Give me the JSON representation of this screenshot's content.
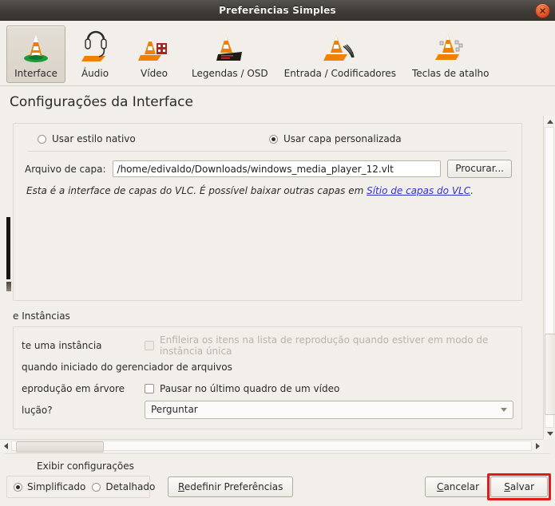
{
  "window": {
    "title": "Preferências Simples",
    "close_icon": "close-icon"
  },
  "toolbar": {
    "items": [
      {
        "label": "Interface",
        "icon": "vlc-cone-interface-icon",
        "selected": true
      },
      {
        "label": "Áudio",
        "icon": "vlc-cone-headphones-icon",
        "selected": false
      },
      {
        "label": "Vídeo",
        "icon": "vlc-cone-film-icon",
        "selected": false
      },
      {
        "label": "Legendas / OSD",
        "icon": "vlc-cone-subtitles-icon",
        "selected": false
      },
      {
        "label": "Entrada / Codificadores",
        "icon": "vlc-cone-input-icon",
        "selected": false
      },
      {
        "label": "Teclas de atalho",
        "icon": "vlc-cone-keyboard-icon",
        "selected": false
      }
    ]
  },
  "page": {
    "title": "Configurações da Interface"
  },
  "look_and_feel": {
    "native_style": {
      "label": "Usar estilo nativo",
      "selected": false
    },
    "custom_skin": {
      "label": "Usar capa personalizada",
      "selected": true
    },
    "skin_file_label": "Arquivo de capa:",
    "skin_file_value": "/home/edivaldo/Downloads/windows_media_player_12.vlt",
    "browse_label": "Procurar...",
    "hint_prefix": "Esta é a interface de capas do VLC. É possível baixar outras capas em ",
    "hint_link": "Sítio de capas do VLC",
    "hint_suffix": "."
  },
  "playlist_section": {
    "title": "e Instâncias",
    "rows": [
      {
        "label": "te uma instância",
        "checkbox_label": "Enfileira os itens na lista de reprodução quando estiver em modo de instância única",
        "checked": false,
        "disabled": true
      },
      {
        "label": "quando iniciado do gerenciador de arquivos",
        "checkbox_label": "",
        "checked": false,
        "disabled": false
      },
      {
        "label": "eprodução em árvore",
        "checkbox_label": "Pausar no último quadro de um vídeo",
        "checked": false,
        "disabled": false
      }
    ],
    "dropdown_label": "lução?",
    "dropdown_value": "Perguntar"
  },
  "scrollbars": {
    "v_up_icon": "triangle-up-icon",
    "v_down_icon": "triangle-down-icon",
    "h_left_icon": "triangle-left-icon",
    "h_right_icon": "triangle-right-icon"
  },
  "footer": {
    "show_settings_label": "Exibir configurações",
    "simple_label": "Simplificado",
    "simple_selected": true,
    "advanced_label": "Detalhado",
    "advanced_selected": false,
    "reset_label_mnemonic": "R",
    "reset_label_rest": "edefinir Preferências",
    "cancel_label_mnemonic": "C",
    "cancel_label_rest": "ancelar",
    "save_label_mnemonic": "S",
    "save_label_rest": "alvar",
    "save_highlight_color": "#e01b1b"
  }
}
